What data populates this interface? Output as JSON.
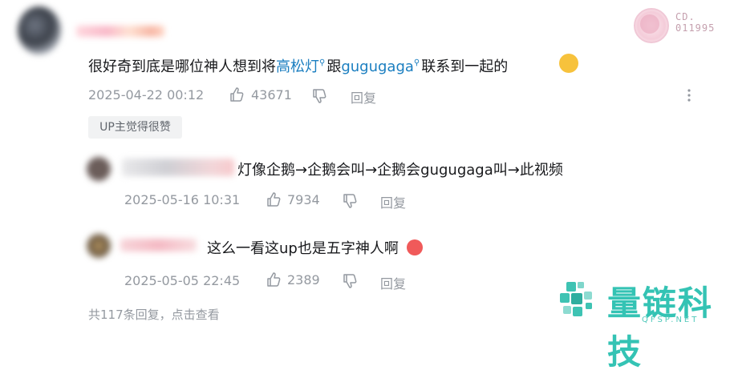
{
  "badge": {
    "top": "CD.",
    "bottom": "011995"
  },
  "main_comment": {
    "text_before": "很好奇到底是哪位神人想到将",
    "link1": "高松灯",
    "text_mid": "跟",
    "link2": "gugugaga",
    "text_after": "联系到一起的",
    "timestamp": "2025-04-22 00:12",
    "likes": "43671",
    "reply_label": "回复",
    "up_tag": "UP主觉得很赞",
    "more_icon": "more-vertical-icon"
  },
  "replies": [
    {
      "text": "灯像企鹅→企鹅会叫→企鹅会gugugaga叫→此视频",
      "timestamp": "2025-05-16 10:31",
      "likes": "7934",
      "reply_label": "回复"
    },
    {
      "text": "这么一看这up也是五字神人啊",
      "timestamp": "2025-05-05 22:45",
      "likes": "2389",
      "reply_label": "回复"
    }
  ],
  "footer": {
    "summary": "共117条回复，点击查看"
  },
  "watermark": {
    "name": "量链科技",
    "domain": "QFSP.NET"
  },
  "colors": {
    "link": "#1a7ec0",
    "meta": "#9499a0",
    "logo": "#34c3b4"
  }
}
